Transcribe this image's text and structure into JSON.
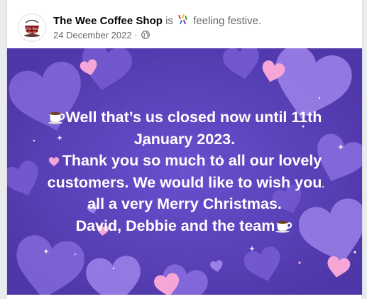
{
  "post": {
    "page_name": "The Wee Coffee Shop",
    "feeling_prefix": "is",
    "feeling_text": "feeling festive.",
    "feeling_icon": "confetti-icon",
    "date": "24 December 2022",
    "date_separator": "·",
    "audience_icon": "globe-icon",
    "avatar_logo_text": "The Wee Coffee Shop"
  },
  "image": {
    "lines": [
      "Well that’s us closed now until 11th",
      "January 2023.",
      "Thank you so much to all our lovely",
      "customers. We would like to wish you",
      "all a very Merry Christmas.",
      "David, Debbie and the team"
    ],
    "line_icons": [
      "coffee-cup-icon",
      "",
      "pink-heart-icon",
      "",
      "",
      "coffee-cup-icon"
    ],
    "colors": {
      "background": "#5b43b5",
      "heart_light": "#9b7fe6",
      "heart_pink": "#f6a6d6",
      "text": "#ffffff"
    }
  }
}
